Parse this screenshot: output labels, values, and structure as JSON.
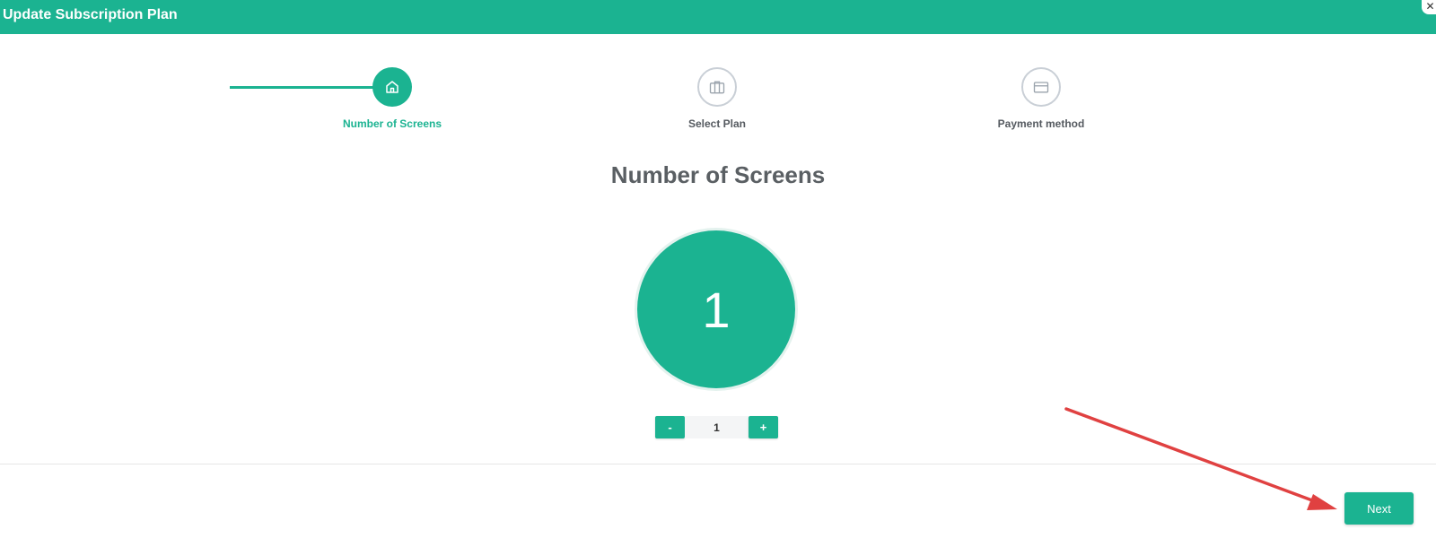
{
  "window": {
    "title": "Update Subscription Plan",
    "close_icon": "close-icon"
  },
  "steps": [
    {
      "label": "Number of Screens",
      "icon": "home-icon",
      "status": "active"
    },
    {
      "label": "Select Plan",
      "icon": "briefcase-icon",
      "status": "inactive"
    },
    {
      "label": "Payment method",
      "icon": "credit-card-icon",
      "status": "inactive"
    }
  ],
  "main": {
    "title": "Number of Screens",
    "count_display": "1"
  },
  "stepper": {
    "minus_label": "-",
    "value": "1",
    "plus_label": "+"
  },
  "footer": {
    "next_label": "Next"
  },
  "colors": {
    "accent": "#1bb391",
    "inactive_border": "#c9cfd6",
    "annotation_arrow": "#e04141"
  }
}
